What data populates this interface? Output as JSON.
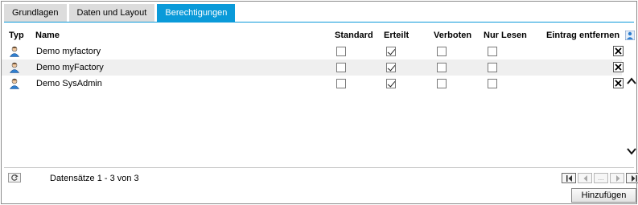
{
  "tabs": [
    {
      "label": "Grundlagen",
      "active": false
    },
    {
      "label": "Daten und Layout",
      "active": false
    },
    {
      "label": "Berechtigungen",
      "active": true
    }
  ],
  "columns": {
    "type": "Typ",
    "name": "Name",
    "standard": "Standard",
    "erteilt": "Erteilt",
    "verboten": "Verboten",
    "nur_lesen": "Nur Lesen",
    "eintrag_entfernen": "Eintrag entfernen"
  },
  "rows": [
    {
      "name": "Demo myfactory",
      "icon": "user-icon",
      "standard": false,
      "erteilt": true,
      "verboten": false,
      "nur_lesen": false
    },
    {
      "name": "Demo myFactory",
      "icon": "user-icon",
      "standard": false,
      "erteilt": true,
      "verboten": false,
      "nur_lesen": false
    },
    {
      "name": "Demo SysAdmin",
      "icon": "user-icon",
      "standard": false,
      "erteilt": true,
      "verboten": false,
      "nur_lesen": false
    }
  ],
  "footer": {
    "records_text": "Datensätze 1 - 3 von 3",
    "pager_ellipsis": "...",
    "add_button": "Hinzufügen"
  },
  "colors": {
    "tab_active": "#0a9ad9",
    "row_alt": "#efefef",
    "icon_blue": "#2f7fd0"
  }
}
